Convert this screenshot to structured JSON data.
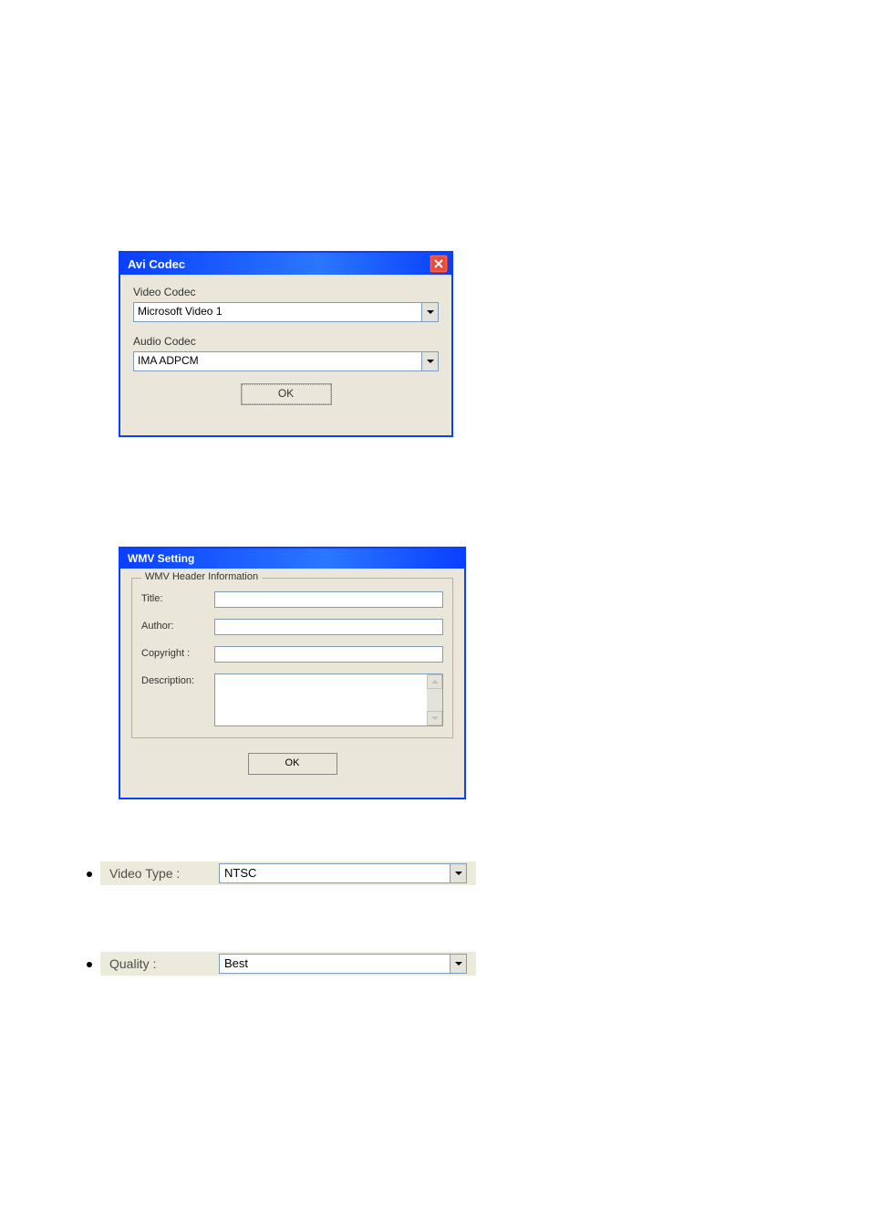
{
  "avi_dialog": {
    "title": "Avi Codec",
    "video_label": "Video Codec",
    "video_value": "Microsoft Video 1",
    "audio_label": "Audio Codec",
    "audio_value": "IMA ADPCM",
    "ok": "OK"
  },
  "wmv_dialog": {
    "title": "WMV Setting",
    "group_label": "WMV Header Information",
    "rows": {
      "title_label": "Title:",
      "title_value": "",
      "author_label": "Author:",
      "author_value": "",
      "copyright_label": "Copyright :",
      "copyright_value": "",
      "description_label": "Description:",
      "description_value": ""
    },
    "ok": "OK"
  },
  "video_type_row": {
    "label": "Video Type :",
    "value": "NTSC"
  },
  "quality_row": {
    "label": "Quality :",
    "value": "Best"
  }
}
